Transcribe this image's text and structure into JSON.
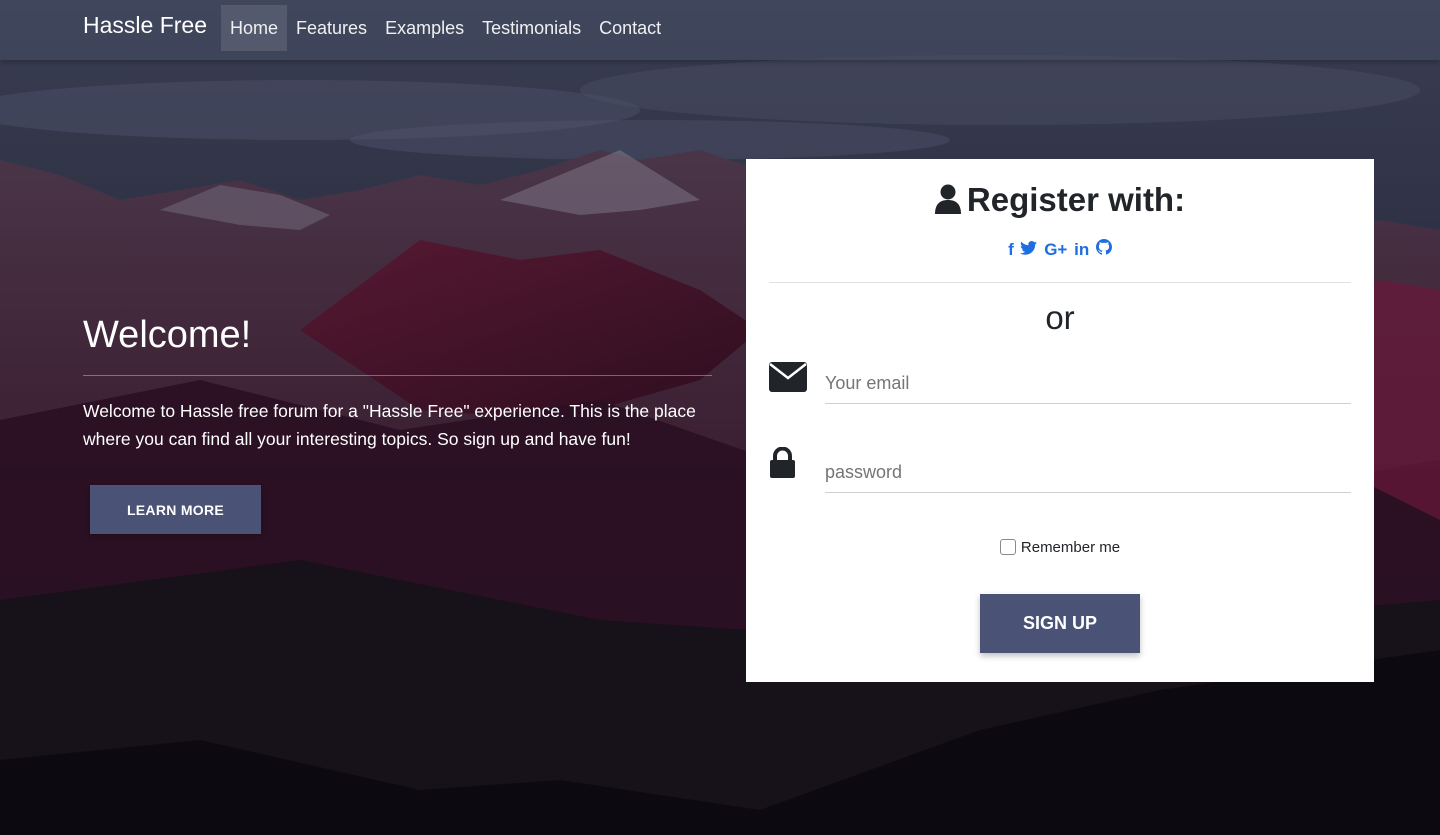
{
  "nav": {
    "brand": "Hassle Free",
    "links": [
      {
        "label": "Home",
        "active": true
      },
      {
        "label": "Features",
        "active": false
      },
      {
        "label": "Examples",
        "active": false
      },
      {
        "label": "Testimonials",
        "active": false
      },
      {
        "label": "Contact",
        "active": false
      }
    ]
  },
  "hero": {
    "title": "Welcome!",
    "text": "Welcome to Hassle free forum for a \"Hassle Free\" experience. This is the place where you can find all your interesting topics. So sign up and have fun!",
    "button": "LEARN MORE"
  },
  "register": {
    "title": "Register with:",
    "title_icon": "user-icon",
    "socials": [
      {
        "icon": "facebook-icon",
        "glyph": "f"
      },
      {
        "icon": "twitter-icon",
        "glyph": ""
      },
      {
        "icon": "google-plus-icon",
        "glyph": "G+"
      },
      {
        "icon": "linkedin-icon",
        "glyph": "in"
      },
      {
        "icon": "github-icon",
        "glyph": ""
      }
    ],
    "or": "or",
    "email_placeholder": "Your email",
    "email_icon": "envelope-icon",
    "password_placeholder": "password",
    "password_icon": "lock-icon",
    "remember": "Remember me",
    "submit": "SIGN UP"
  },
  "colors": {
    "accent": "#4a5275",
    "social_blue": "#1e6ee0",
    "navbar": "#464c64"
  }
}
